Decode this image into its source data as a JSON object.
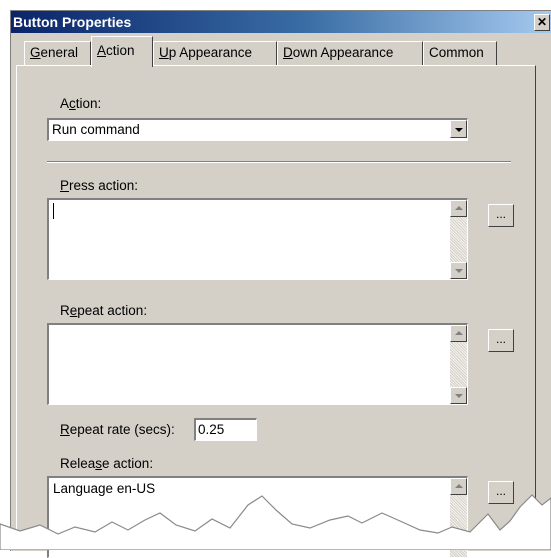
{
  "window": {
    "title": "Button Properties",
    "close_glyph": "✕"
  },
  "tabs": [
    {
      "before": "",
      "key": "G",
      "after": "eneral"
    },
    {
      "before": "",
      "key": "A",
      "after": "ction"
    },
    {
      "before": "",
      "key": "U",
      "after": "p Appearance"
    },
    {
      "before": "",
      "key": "D",
      "after": "own Appearance"
    },
    {
      "before": "Common",
      "key": "",
      "after": ""
    }
  ],
  "active_tab": "Action",
  "action": {
    "label_before": "A",
    "label_key": "c",
    "label_after": "tion:",
    "value": "Run command"
  },
  "press_action": {
    "label_before": "",
    "label_key": "P",
    "label_after": "ress action:",
    "value": "",
    "browse_label": "..."
  },
  "repeat_action": {
    "label_before": "R",
    "label_key": "e",
    "label_after": "peat action:",
    "value": "",
    "browse_label": "..."
  },
  "repeat_rate": {
    "label_before": "",
    "label_key": "R",
    "label_after": "epeat rate (secs):",
    "value": "0.25"
  },
  "release_action": {
    "label_before": "Relea",
    "label_key": "s",
    "label_after": "e action:",
    "value": "Language en-US",
    "browse_label": "..."
  },
  "icons": {
    "dropdown": "chevron-down-icon",
    "scroll_up": "arrow-up-icon",
    "scroll_down": "arrow-down-icon",
    "close": "close-icon"
  },
  "colors": {
    "dialog_face": "#d4d0c8",
    "title_start": "#0a246a",
    "title_end": "#a6caf0"
  }
}
